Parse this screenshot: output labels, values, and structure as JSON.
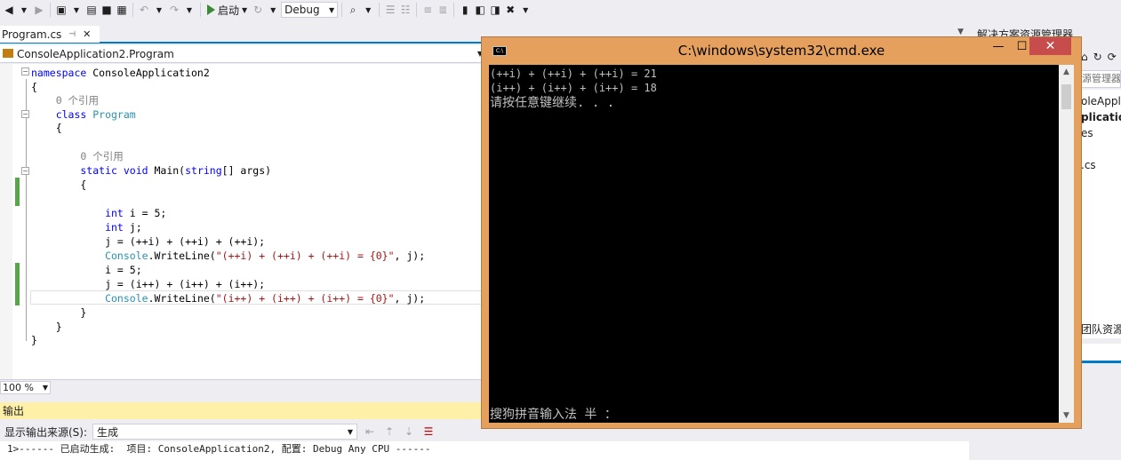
{
  "toolbar": {
    "start_label": "启动",
    "config_value": "Debug"
  },
  "doc_tab": {
    "filename": "Program.cs",
    "pin_icon": "pin-icon",
    "close_icon": "close-icon"
  },
  "nav": {
    "class_path": "ConsoleApplication2.Program"
  },
  "code": {
    "lines": [
      {
        "segments": [
          {
            "t": "namespace",
            "c": "kw"
          },
          {
            "t": " ConsoleApplication2",
            "c": "tx"
          }
        ]
      },
      {
        "segments": [
          {
            "t": "{",
            "c": "tx"
          }
        ]
      },
      {
        "segments": [
          {
            "t": "    0 个引用",
            "c": "cm"
          }
        ]
      },
      {
        "segments": [
          {
            "t": "    class",
            "c": "kw"
          },
          {
            "t": " Program",
            "c": "ty"
          }
        ]
      },
      {
        "segments": [
          {
            "t": "    {",
            "c": "tx"
          }
        ]
      },
      {
        "segments": [
          {
            "t": "",
            "c": "tx"
          }
        ]
      },
      {
        "segments": [
          {
            "t": "        0 个引用",
            "c": "cm"
          }
        ]
      },
      {
        "segments": [
          {
            "t": "        static void",
            "c": "kw"
          },
          {
            "t": " Main(",
            "c": "tx"
          },
          {
            "t": "string",
            "c": "kw"
          },
          {
            "t": "[] args)",
            "c": "tx"
          }
        ]
      },
      {
        "segments": [
          {
            "t": "        {",
            "c": "tx"
          }
        ]
      },
      {
        "segments": [
          {
            "t": "",
            "c": "tx"
          }
        ]
      },
      {
        "segments": [
          {
            "t": "            int",
            "c": "kw"
          },
          {
            "t": " i = 5;",
            "c": "tx"
          }
        ]
      },
      {
        "segments": [
          {
            "t": "            int",
            "c": "kw"
          },
          {
            "t": " j;",
            "c": "tx"
          }
        ]
      },
      {
        "segments": [
          {
            "t": "            j = (++i) + (++i) + (++i);",
            "c": "tx"
          }
        ]
      },
      {
        "segments": [
          {
            "t": "            Console",
            "c": "ty"
          },
          {
            "t": ".WriteLine(",
            "c": "tx"
          },
          {
            "t": "\"(++i) + (++i) + (++i) = {0}\"",
            "c": "st"
          },
          {
            "t": ", j);",
            "c": "tx"
          }
        ]
      },
      {
        "segments": [
          {
            "t": "            i = 5;",
            "c": "tx"
          }
        ]
      },
      {
        "segments": [
          {
            "t": "            j = (i++) + (i++) + (i++);",
            "c": "tx"
          }
        ]
      },
      {
        "segments": [
          {
            "t": "            Console",
            "c": "ty"
          },
          {
            "t": ".WriteLine(",
            "c": "tx"
          },
          {
            "t": "\"(i++) + (i++) + (i++) = {0}\"",
            "c": "st"
          },
          {
            "t": ", j);",
            "c": "tx"
          }
        ]
      },
      {
        "segments": [
          {
            "t": "        }",
            "c": "tx"
          }
        ]
      },
      {
        "segments": [
          {
            "t": "    }",
            "c": "tx"
          }
        ]
      },
      {
        "segments": [
          {
            "t": "}",
            "c": "tx"
          }
        ]
      }
    ]
  },
  "zoom": {
    "value": "100 %"
  },
  "output": {
    "header": "输出",
    "source_label": "显示输出来源(S):",
    "source_value": "生成",
    "line1": "1>------ 已启动生成:  项目: ConsoleApplication2, 配置: Debug Any CPU ------"
  },
  "solution": {
    "title": "解决方案资源管理器",
    "search_placeholder": "源管理器(Ctrl+",
    "items": [
      "oleApplic",
      "plication",
      "es",
      ".cs"
    ],
    "team_tab": "团队资源"
  },
  "cmd": {
    "title": "C:\\windows\\system32\\cmd.exe",
    "lines": [
      "(++i) + (++i) + (++i) = 21",
      "(i++) + (i++) + (i++) = 18",
      "请按任意键继续. . ."
    ],
    "ime_status": "搜狗拼音输入法 半 ："
  }
}
